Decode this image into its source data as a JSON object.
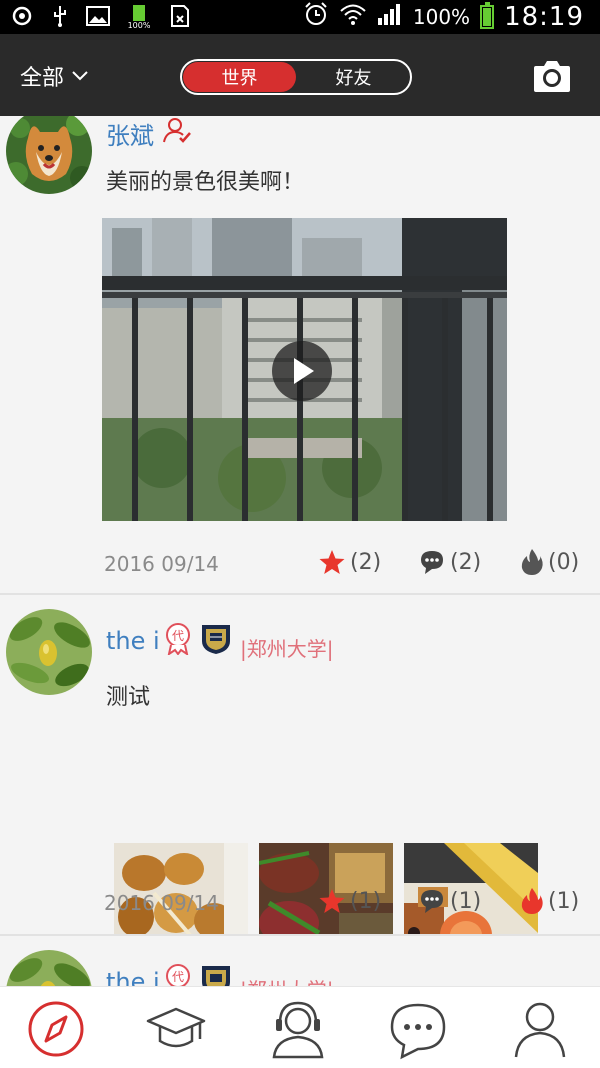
{
  "status_bar": {
    "battery_small": "100%",
    "battery_percent": "100%",
    "time": "18:19",
    "icons": [
      "netease-music-icon",
      "usb-icon",
      "image-icon",
      "battery-small-icon",
      "sim-icon",
      "alarm-icon",
      "wifi-icon",
      "signal-icon",
      "battery-icon"
    ]
  },
  "header": {
    "filter_label": "全部",
    "tabs": [
      {
        "label": "世界",
        "active": true
      },
      {
        "label": "好友",
        "active": false
      }
    ],
    "camera_icon": "camera-icon"
  },
  "posts": [
    {
      "username": "张斌",
      "content": "美丽的景色很美啊！",
      "media_type": "video",
      "date": "2016 09/14",
      "likes": "(2)",
      "comments": "(2)",
      "hot": "(0)"
    },
    {
      "username": "the i",
      "school": "|郑州大学|",
      "content": "测试",
      "media_type": "images",
      "image_count": 3,
      "date": "2016 09/14",
      "likes": "(1)",
      "comments": "(1)",
      "hot": "(1)"
    },
    {
      "username": "the i",
      "school": "|郑州大学|"
    }
  ],
  "colors": {
    "accent": "#d62f2f",
    "username": "#3f7fbf",
    "school": "#e0707a",
    "appbar": "#2a2a2a"
  },
  "bottom_nav": [
    "compass-icon",
    "graduation-cap-icon",
    "headset-user-icon",
    "chat-bubble-icon",
    "profile-icon"
  ]
}
